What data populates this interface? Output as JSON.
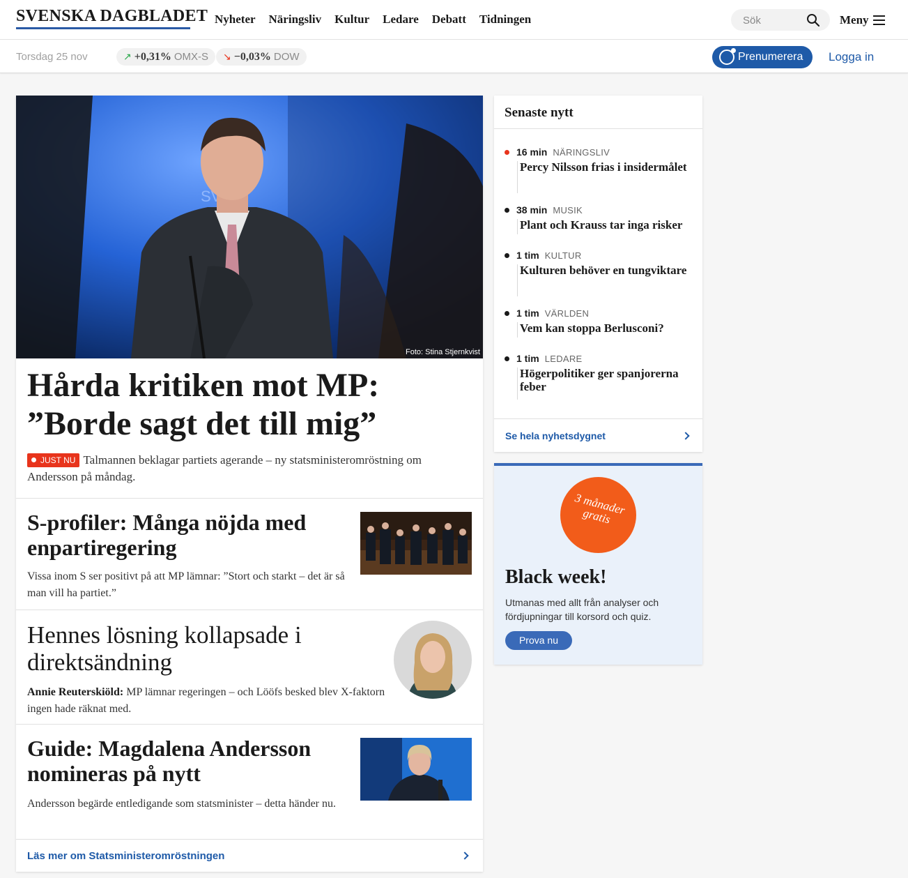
{
  "header": {
    "logo": "SVENSKA DAGBLADET",
    "nav": [
      "Nyheter",
      "Näringsliv",
      "Kultur",
      "Ledare",
      "Debatt",
      "Tidningen"
    ],
    "search_placeholder": "Sök",
    "menu_label": "Meny"
  },
  "subbar": {
    "date": "Torsdag 25 nov",
    "tickers": [
      {
        "arrow": "↗",
        "value": "+0,31%",
        "index": "OMX-S",
        "color": "#2aa84a"
      },
      {
        "arrow": "↘",
        "value": "−0,03%",
        "index": "DOW",
        "color": "#e8341c"
      }
    ],
    "subscribe_label": "Prenumerera",
    "login_label": "Logga in"
  },
  "hero": {
    "credit": "Foto: Stina Stjernkvist",
    "title": "Hårda kritiken mot MP: ”Borde sagt det till mig”",
    "badge": "JUST NU",
    "lead": "Talmannen beklagar partiets agerande – ny statsministeromröstning om Andersson på måndag."
  },
  "articles": [
    {
      "title": "S-profiler: Många nöjda med enpartiregering",
      "lead": "Vissa inom S ser positivt på att MP lämnar: ”Stort och starkt – det är så man vill ha partiet.”"
    },
    {
      "title": "Hennes lösning kollapsade i direktsändning",
      "author": "Annie Reuterskiöld:",
      "lead": "MP lämnar regeringen – och Lööfs besked blev X-faktorn ingen hade räknat med."
    },
    {
      "title": "Guide: Magdalena Andersson nomineras på nytt",
      "lead": "Andersson begärde entledigande som statsminister – detta händer nu."
    }
  ],
  "more_link": "Läs mer om Statsministeromröstningen",
  "latest": {
    "heading": "Senaste nytt",
    "items": [
      {
        "time": "16 min",
        "category": "NÄRINGSLIV",
        "title": "Percy Nilsson frias i insidermålet"
      },
      {
        "time": "38 min",
        "category": "MUSIK",
        "title": "Plant och Krauss tar inga risker"
      },
      {
        "time": "1 tim",
        "category": "KULTUR",
        "title": "Kulturen behöver en tungviktare"
      },
      {
        "time": "1 tim",
        "category": "VÄRLDEN",
        "title": "Vem kan stoppa Berlusconi?"
      },
      {
        "time": "1 tim",
        "category": "LEDARE",
        "title": "Högerpolitiker ger spanjorerna feber"
      }
    ],
    "footer": "Se hela nyhetsdygnet"
  },
  "promo": {
    "circle_line1": "3 månader",
    "circle_line2": "gratis",
    "title": "Black week!",
    "text": "Utmanas med allt från analyser och fördjupningar till korsord och quiz.",
    "button": "Prova nu"
  }
}
